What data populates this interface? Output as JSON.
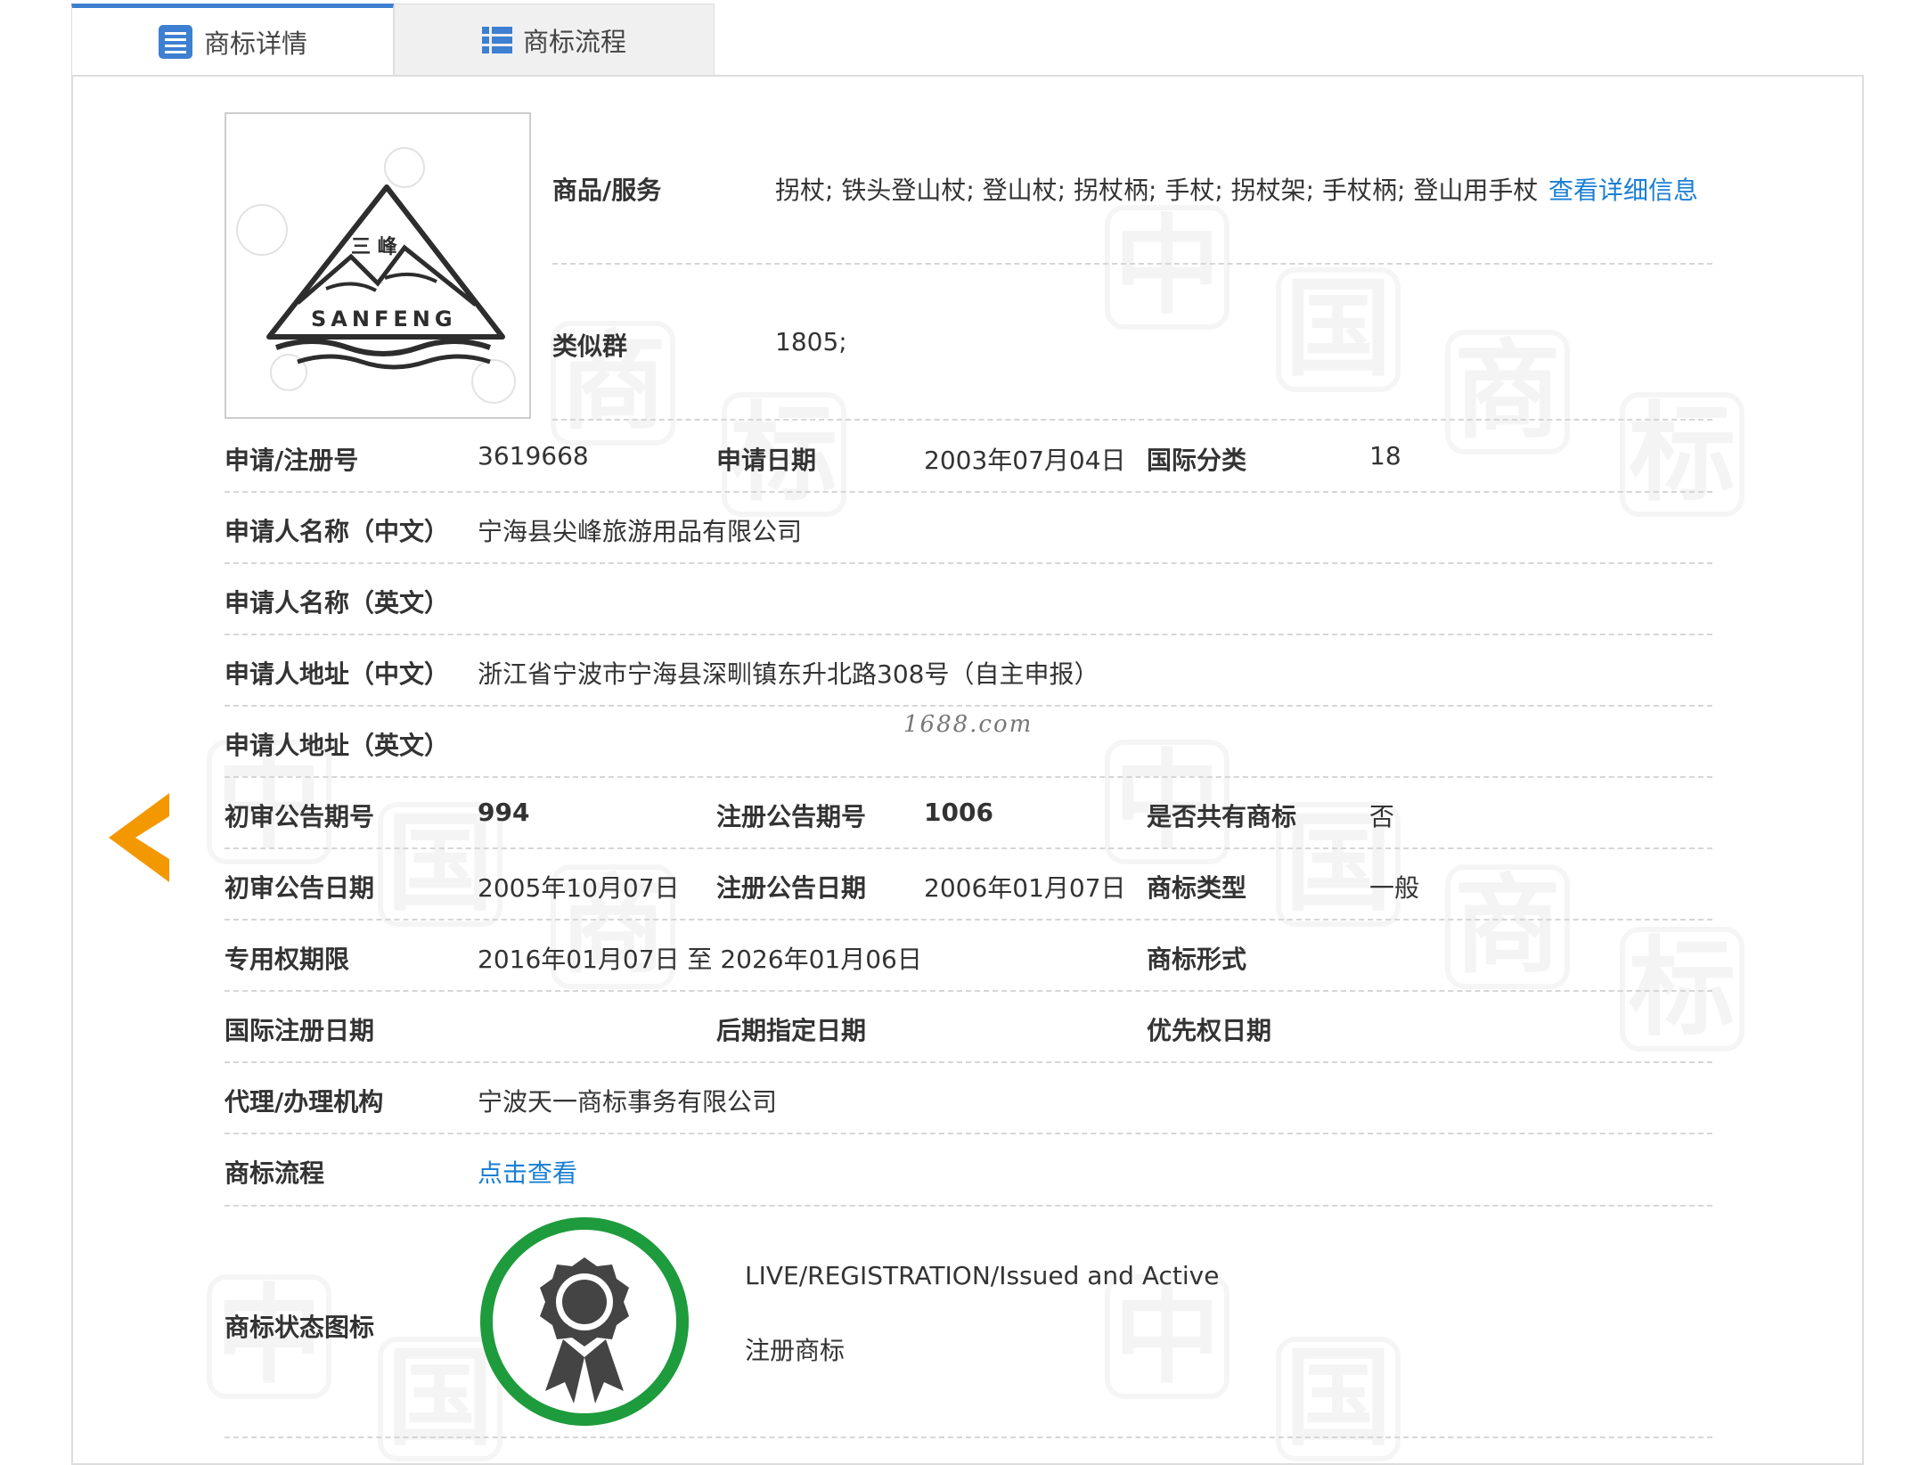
{
  "tabs": [
    {
      "label": "商标详情",
      "active": true,
      "icon": "list-icon"
    },
    {
      "label": "商标流程",
      "active": false,
      "icon": "grid-list-icon"
    }
  ],
  "logo": {
    "chinese_text": "三 峰",
    "english_text": "SANFENG"
  },
  "goods": {
    "label": "商品/服务",
    "value": "拐杖; 铁头登山杖; 登山杖; 拐杖柄; 手杖; 拐杖架; 手杖柄; 登山用手杖",
    "detail_link": "查看详细信息"
  },
  "similar_group": {
    "label": "类似群",
    "value": "1805;"
  },
  "rows": {
    "reg_no_label": "申请/注册号",
    "reg_no": "3619668",
    "apply_date_label": "申请日期",
    "apply_date": "2003年07月04日",
    "intl_class_label": "国际分类",
    "intl_class": "18",
    "applicant_cn_label": "申请人名称（中文）",
    "applicant_cn": "宁海县尖峰旅游用品有限公司",
    "applicant_en_label": "申请人名称（英文）",
    "address_cn_label": "申请人地址（中文）",
    "address_cn": "浙江省宁波市宁海县深甽镇东升北路308号（自主申报）",
    "address_en_label": "申请人地址（英文）",
    "prelim_issue_label": "初审公告期号",
    "prelim_issue": "994",
    "reg_issue_label": "注册公告期号",
    "reg_issue": "1006",
    "shared_label": "是否共有商标",
    "shared": "否",
    "prelim_date_label": "初审公告日期",
    "prelim_date": "2005年10月07日",
    "reg_date_label": "注册公告日期",
    "reg_date": "2006年01月07日",
    "type_label": "商标类型",
    "type": "一般",
    "term_label": "专用权期限",
    "term": "2016年01月07日 至 2026年01月06日",
    "form_label": "商标形式",
    "intl_reg_date_label": "国际注册日期",
    "later_date_label": "后期指定日期",
    "priority_date_label": "优先权日期",
    "agent_label": "代理/办理机构",
    "agent": "宁波天一商标事务有限公司",
    "process_label": "商标流程",
    "process_link": "点击查看",
    "status_label": "商标状态图标",
    "status_en": "LIVE/REGISTRATION/Issued and Active",
    "status_cn": "注册商标"
  },
  "watermark_site": "1688.com",
  "colors": {
    "accent": "#3d7fd1",
    "link": "#1a7fd4",
    "status_ring": "#1e9b3c",
    "arrow": "#f39800"
  }
}
